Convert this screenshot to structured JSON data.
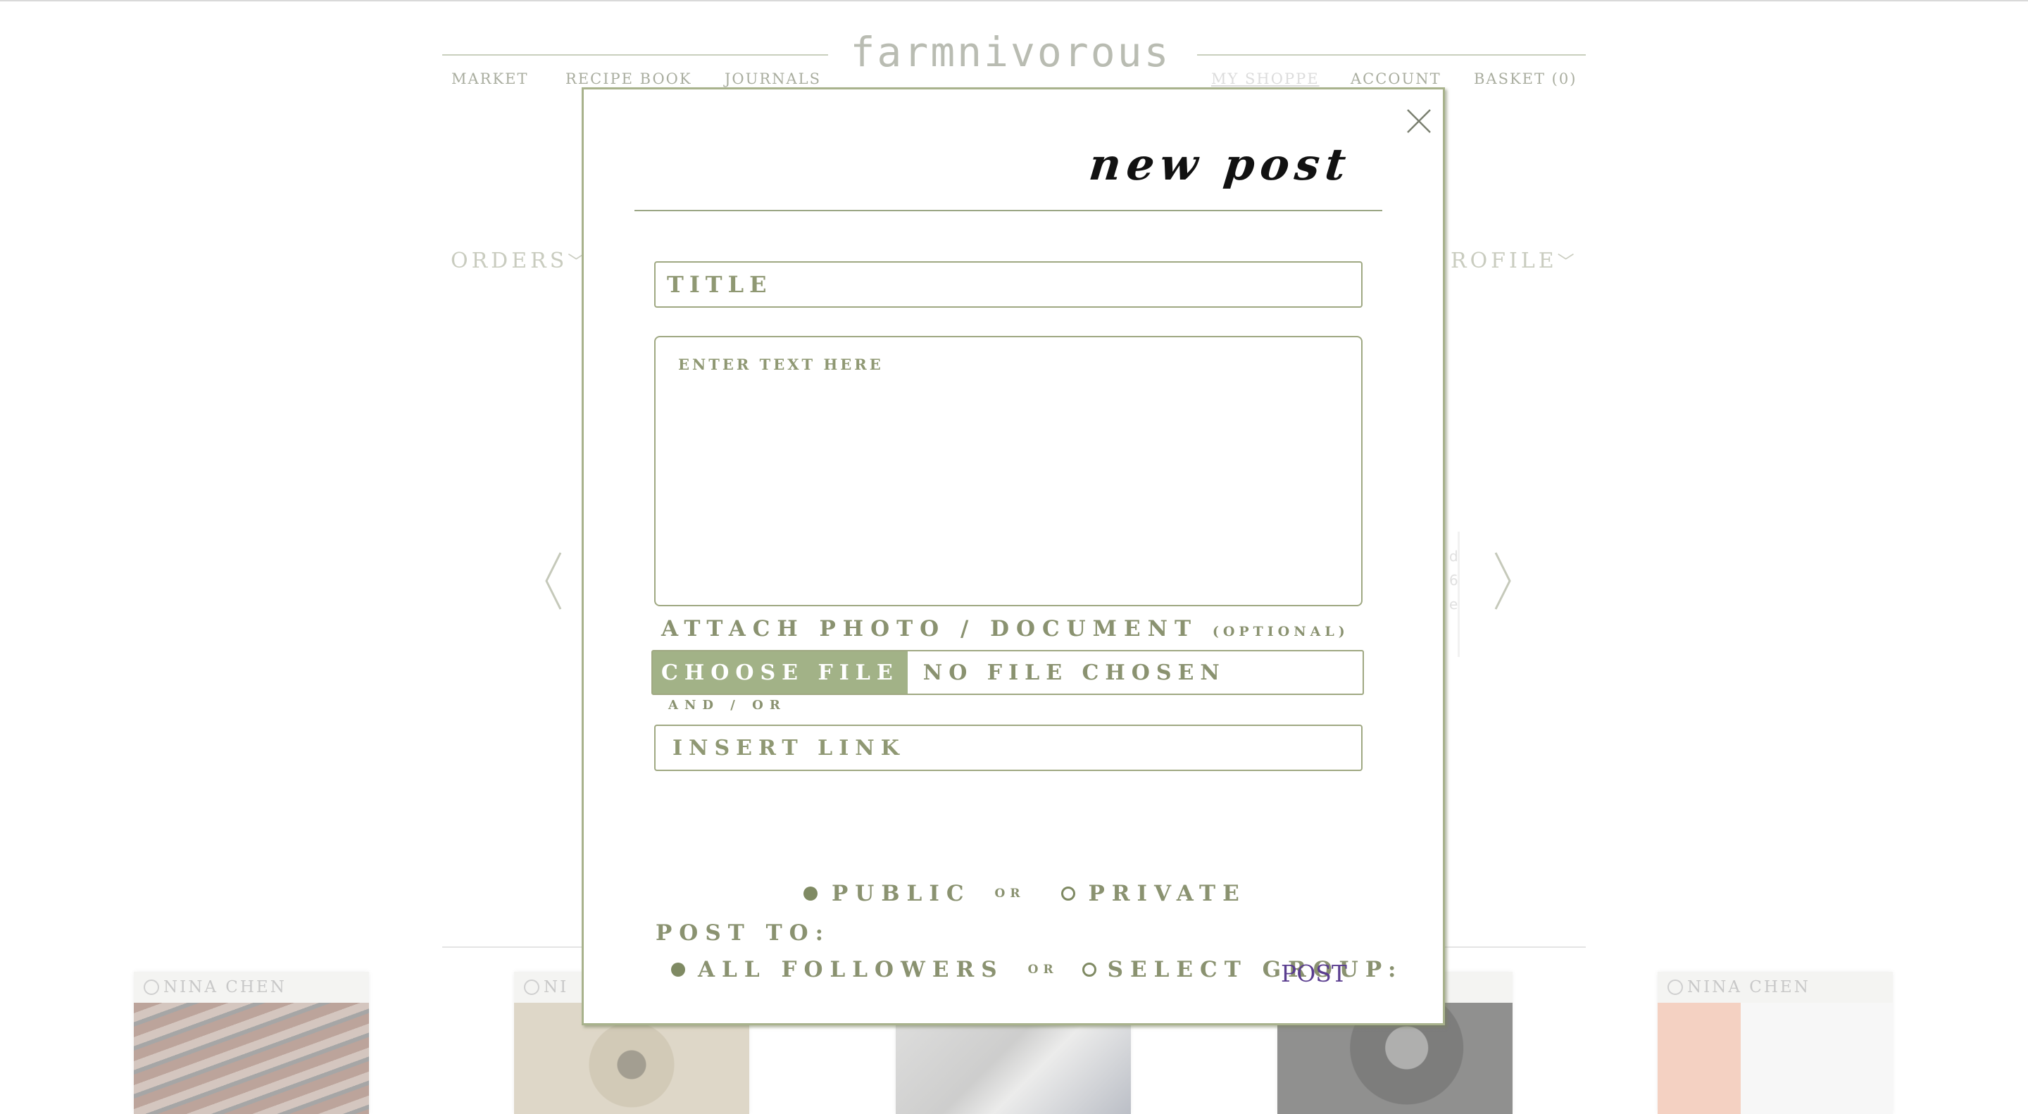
{
  "site": {
    "logo": "farmnivorous",
    "nav": {
      "market": "MARKET",
      "recipe_book": "RECIPE BOOK",
      "journals": "JOURNALS",
      "my_shoppe": "MY SHOPPE",
      "account": "ACCOUNT",
      "basket": "BASKET (0)"
    },
    "tabs": {
      "orders": "ORDERS",
      "profile": "ROFILE"
    },
    "peek_text": [
      "d",
      "6",
      "e"
    ],
    "cards": [
      {
        "author": "NINA CHEN"
      },
      {
        "author": "NI"
      },
      {
        "author": ""
      },
      {
        "author": ""
      },
      {
        "author": "NINA CHEN"
      }
    ]
  },
  "modal": {
    "title": "new post",
    "title_placeholder": "TITLE",
    "body_placeholder": "ENTER TEXT HERE",
    "attach_label": "ATTACH PHOTO / DOCUMENT",
    "attach_optional": "(OPTIONAL)",
    "choose_file": "CHOOSE FILE",
    "no_file": "NO FILE CHOSEN",
    "and_or": "AND / OR",
    "link_placeholder": "INSERT LINK",
    "visibility": {
      "public": "PUBLIC",
      "or": "OR",
      "private": "PRIVATE",
      "selected": "public"
    },
    "post_to_label": "POST TO:",
    "audience": {
      "all_followers": "ALL FOLLOWERS",
      "or": "OR",
      "select_group": "SELECT GROUP:",
      "selected": "all_followers"
    },
    "post_button": "POST"
  },
  "colors": {
    "accent_green": "#a2b287",
    "text_green": "#8a9270",
    "post_purple": "#5a3d8f"
  }
}
